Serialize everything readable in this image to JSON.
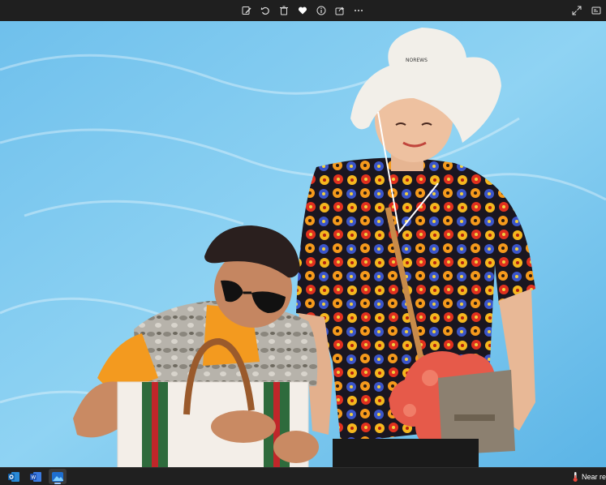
{
  "toolbar": {
    "actions": [
      {
        "name": "edit-image-icon"
      },
      {
        "name": "rotate-icon"
      },
      {
        "name": "delete-icon"
      },
      {
        "name": "favorite-heart-icon"
      },
      {
        "name": "file-info-icon"
      },
      {
        "name": "share-icon"
      },
      {
        "name": "more-options-icon"
      }
    ],
    "right_actions": [
      {
        "name": "fullscreen-icon"
      },
      {
        "name": "slideshow-icon"
      }
    ]
  },
  "photo": {
    "description_subject": "two elderly women against a blue water background",
    "hat_text": "NOREWS",
    "background_color": "#7ec9ee"
  },
  "taskbar": {
    "apps": [
      {
        "name": "outlook-app-icon",
        "active": false
      },
      {
        "name": "word-app-icon",
        "active": false
      },
      {
        "name": "photos-app-icon",
        "active": true
      }
    ],
    "weather_text": "Near re"
  }
}
